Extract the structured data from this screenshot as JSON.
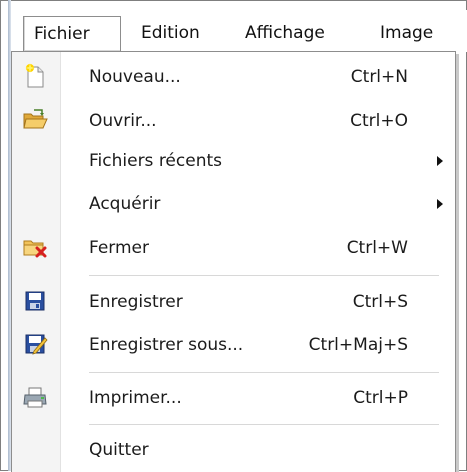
{
  "menubar": {
    "items": [
      {
        "label": "Fichier"
      },
      {
        "label": "Edition"
      },
      {
        "label": "Affichage"
      },
      {
        "label": "Image"
      }
    ]
  },
  "file_menu": {
    "items": [
      {
        "label": "Nouveau...",
        "shortcut": "Ctrl+N",
        "icon": "new-document-icon"
      },
      {
        "label": "Ouvrir...",
        "shortcut": "Ctrl+O",
        "icon": "open-folder-icon"
      },
      {
        "label": "Fichiers récents",
        "submenu": true
      },
      {
        "label": "Acquérir",
        "submenu": true
      },
      {
        "label": "Fermer",
        "shortcut": "Ctrl+W",
        "icon": "close-folder-icon"
      },
      {
        "label": "Enregistrer",
        "shortcut": "Ctrl+S",
        "icon": "save-icon"
      },
      {
        "label": "Enregistrer sous...",
        "shortcut": "Ctrl+Maj+S",
        "icon": "save-as-icon"
      },
      {
        "label": "Imprimer...",
        "shortcut": "Ctrl+P",
        "icon": "print-icon"
      },
      {
        "label": "Quitter"
      }
    ]
  },
  "colors": {
    "icon_column": "#f4f4f4",
    "border": "#8d8d8d",
    "separator": "#d8d8d8",
    "save_blue": "#2a4fa0"
  }
}
